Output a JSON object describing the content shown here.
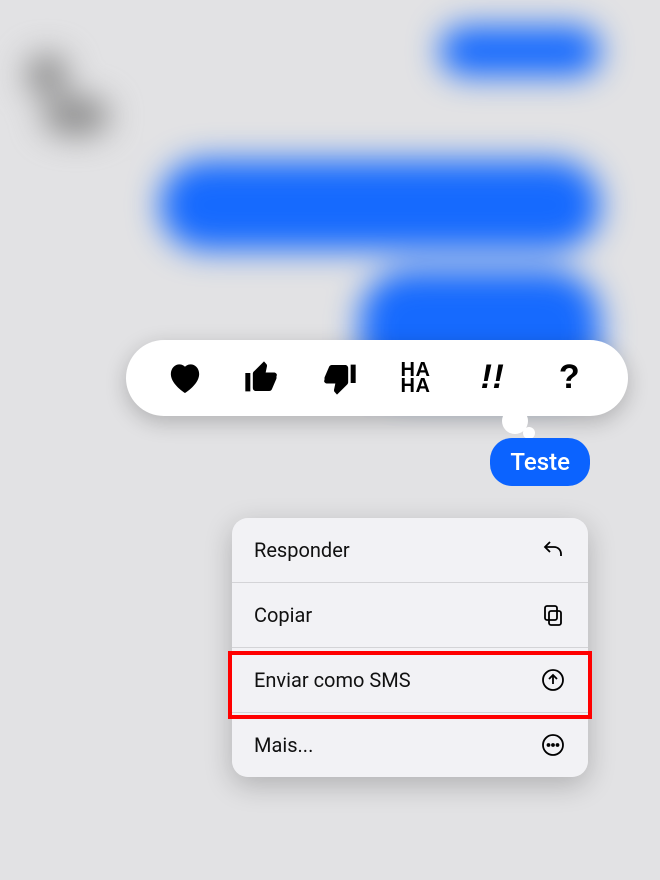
{
  "message": {
    "text": "Teste"
  },
  "reactions": [
    {
      "name": "heart"
    },
    {
      "name": "thumbs-up"
    },
    {
      "name": "thumbs-down"
    },
    {
      "name": "haha",
      "text": "HA\nHA"
    },
    {
      "name": "exclaim",
      "text": "!!"
    },
    {
      "name": "question",
      "text": "?"
    }
  ],
  "menu": {
    "items": [
      {
        "label": "Responder",
        "icon": "reply"
      },
      {
        "label": "Copiar",
        "icon": "copy"
      },
      {
        "label": "Enviar como SMS",
        "icon": "send"
      },
      {
        "label": "Mais...",
        "icon": "more"
      }
    ]
  }
}
